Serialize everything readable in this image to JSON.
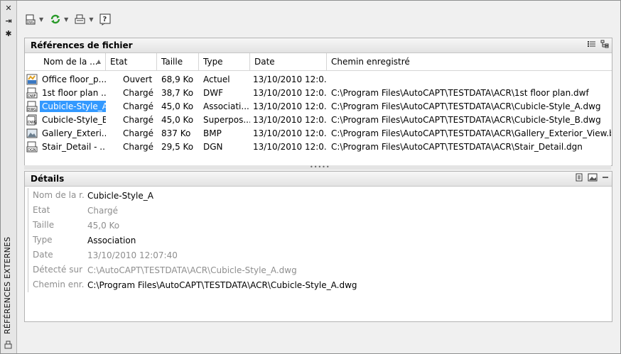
{
  "side": {
    "close_glyph": "✕",
    "autohide_glyph": "⇥",
    "props_glyph": "✱",
    "title": "RÉFÉRENCES EXTERNES"
  },
  "toolbar": {
    "attach_icon": "attach-dwg-icon",
    "refresh_icon": "refresh-icon",
    "change_path_icon": "change-path-icon",
    "help_icon": "help-icon",
    "help_glyph": "?"
  },
  "file_refs": {
    "title": "Références de fichier",
    "columns": [
      "Nom de la ...",
      "Etat",
      "Taille",
      "Type",
      "Date",
      "Chemin enregistré"
    ],
    "rows": [
      {
        "icon": "drawing-icon",
        "name": "Office floor_p...",
        "status": "Ouvert",
        "size": "68,9 Ko",
        "type": "Actuel",
        "date": "13/10/2010 12:0...",
        "path": ""
      },
      {
        "icon": "dwf-icon",
        "name": "1st floor plan ...",
        "status": "Chargé",
        "size": "38,7 Ko",
        "type": "DWF",
        "date": "13/10/2010 12:0...",
        "path": "C:\\Program Files\\AutoCAPT\\TESTDATA\\ACR\\1st floor plan.dwf"
      },
      {
        "icon": "dwg-icon",
        "name": "Cubicle-Style_A",
        "status": "Chargé",
        "size": "45,0 Ko",
        "type": "Associati...",
        "date": "13/10/2010 12:0...",
        "path": "C:\\Program Files\\AutoCAPT\\TESTDATA\\ACR\\Cubicle-Style_A.dwg",
        "selected": true
      },
      {
        "icon": "dwg-overlay-icon",
        "name": "Cubicle-Style_B",
        "status": "Chargé",
        "size": "45,0 Ko",
        "type": "Superpos...",
        "date": "13/10/2010 12:0...",
        "path": "C:\\Program Files\\AutoCAPT\\TESTDATA\\ACR\\Cubicle-Style_B.dwg"
      },
      {
        "icon": "image-icon",
        "name": "Gallery_Exteri...",
        "status": "Chargé",
        "size": "837 Ko",
        "type": "BMP",
        "date": "13/10/2010 12:0...",
        "path": "C:\\Program Files\\AutoCAPT\\TESTDATA\\ACR\\Gallery_Exterior_View.bmp"
      },
      {
        "icon": "dgn-icon",
        "name": "Stair_Detail - ...",
        "status": "Chargé",
        "size": "29,5 Ko",
        "type": "DGN",
        "date": "13/10/2010 12:0...",
        "path": "C:\\Program Files\\AutoCAPT\\TESTDATA\\ACR\\Stair_Detail.dgn"
      }
    ]
  },
  "details": {
    "title": "Détails",
    "fields": [
      {
        "label": "Nom de la r...",
        "value": "Cubicle-Style_A",
        "muted": false
      },
      {
        "label": "Etat",
        "value": "Chargé",
        "muted": true
      },
      {
        "label": "Taille",
        "value": "45,0 Ko",
        "muted": true
      },
      {
        "label": "Type",
        "value": "Association",
        "muted": false
      },
      {
        "label": "Date",
        "value": "13/10/2010 12:07:40",
        "muted": true
      },
      {
        "label": "Détecté sur",
        "value": "C:\\AutoCAPT\\TESTDATA\\ACR\\Cubicle-Style_A.dwg",
        "muted": true
      },
      {
        "label": "Chemin enr...",
        "value": "C:\\Program Files\\AutoCAPT\\TESTDATA\\ACR\\Cubicle-Style_A.dwg",
        "muted": false
      }
    ]
  },
  "colors": {
    "selection": "#3399ff",
    "refresh": "#2a9a2a"
  }
}
